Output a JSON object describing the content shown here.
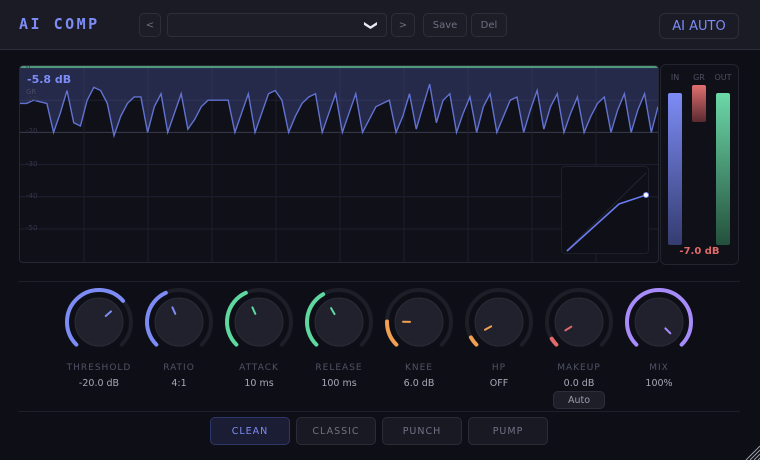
{
  "header": {
    "title": "AI COMP",
    "prev_label": "<",
    "next_label": ">",
    "preset_value": "",
    "save_label": "Save",
    "del_label": "Del",
    "ai_auto_label": "AI AUTO"
  },
  "graph": {
    "gr_readout": "-5.8 dB",
    "gr_label": "GR",
    "db_ticks": [
      "0",
      "-10",
      "-20",
      "-30",
      "-40",
      "-50"
    ],
    "gr_history": [
      -11,
      -11,
      -10,
      -10.5,
      -11,
      -20,
      -14,
      -7,
      -17,
      -18,
      -10,
      -6,
      -7,
      -11,
      -21,
      -15,
      -11,
      -9,
      -9,
      -20,
      -12,
      -8,
      -20,
      -14,
      -8,
      -19,
      -16,
      -12,
      -10,
      -10,
      -10,
      -10,
      -20,
      -14,
      -8,
      -20,
      -14,
      -8,
      -7,
      -10,
      -20,
      -15,
      -11,
      -9,
      -8,
      -20,
      -14,
      -8,
      -20,
      -14,
      -8,
      -20,
      -16,
      -12,
      -11,
      -10,
      -20,
      -15,
      -8,
      -19,
      -12,
      -5,
      -17,
      -10,
      -8,
      -20,
      -14,
      -9,
      -20,
      -12,
      -8,
      -20,
      -15,
      -10,
      -9,
      -20,
      -13,
      -7,
      -19,
      -12,
      -8,
      -20,
      -14,
      -9,
      -20,
      -15,
      -11,
      -9,
      -20,
      -13,
      -8,
      -20,
      -13,
      -8,
      -20,
      -12
    ],
    "transfer_curve": {
      "threshold_db": -20,
      "ratio": 4
    }
  },
  "meters": {
    "labels": [
      "IN",
      "GR",
      "OUT"
    ],
    "levels": [
      0.95,
      0.23,
      0.95
    ],
    "gr_readout": "-7.0 dB"
  },
  "knobs": [
    {
      "label": "THRESHOLD",
      "value": "-20.0 dB",
      "fraction": 0.68,
      "color": "#7d8cf5"
    },
    {
      "label": "RATIO",
      "value": "4:1",
      "fraction": 0.41,
      "color": "#7d8cf5"
    },
    {
      "label": "ATTACK",
      "value": "10 ms",
      "fraction": 0.41,
      "color": "#5fd8a0"
    },
    {
      "label": "RELEASE",
      "value": "100 ms",
      "fraction": 0.39,
      "color": "#5fd8a0"
    },
    {
      "label": "KNEE",
      "value": "6.0 dB",
      "fraction": 0.17,
      "color": "#f0a050"
    },
    {
      "label": "HP",
      "value": "OFF",
      "fraction": 0.06,
      "color": "#f0a050"
    },
    {
      "label": "MAKEUP",
      "value": "0.0 dB",
      "fraction": 0.05,
      "color": "#e06a6a"
    },
    {
      "label": "MIX",
      "value": "100%",
      "fraction": 1.0,
      "color": "#a78bfa"
    }
  ],
  "makeup_auto_label": "Auto",
  "modes": [
    {
      "label": "CLEAN",
      "active": true
    },
    {
      "label": "CLASSIC",
      "active": false
    },
    {
      "label": "PUNCH",
      "active": false
    },
    {
      "label": "PUMP",
      "active": false
    }
  ]
}
